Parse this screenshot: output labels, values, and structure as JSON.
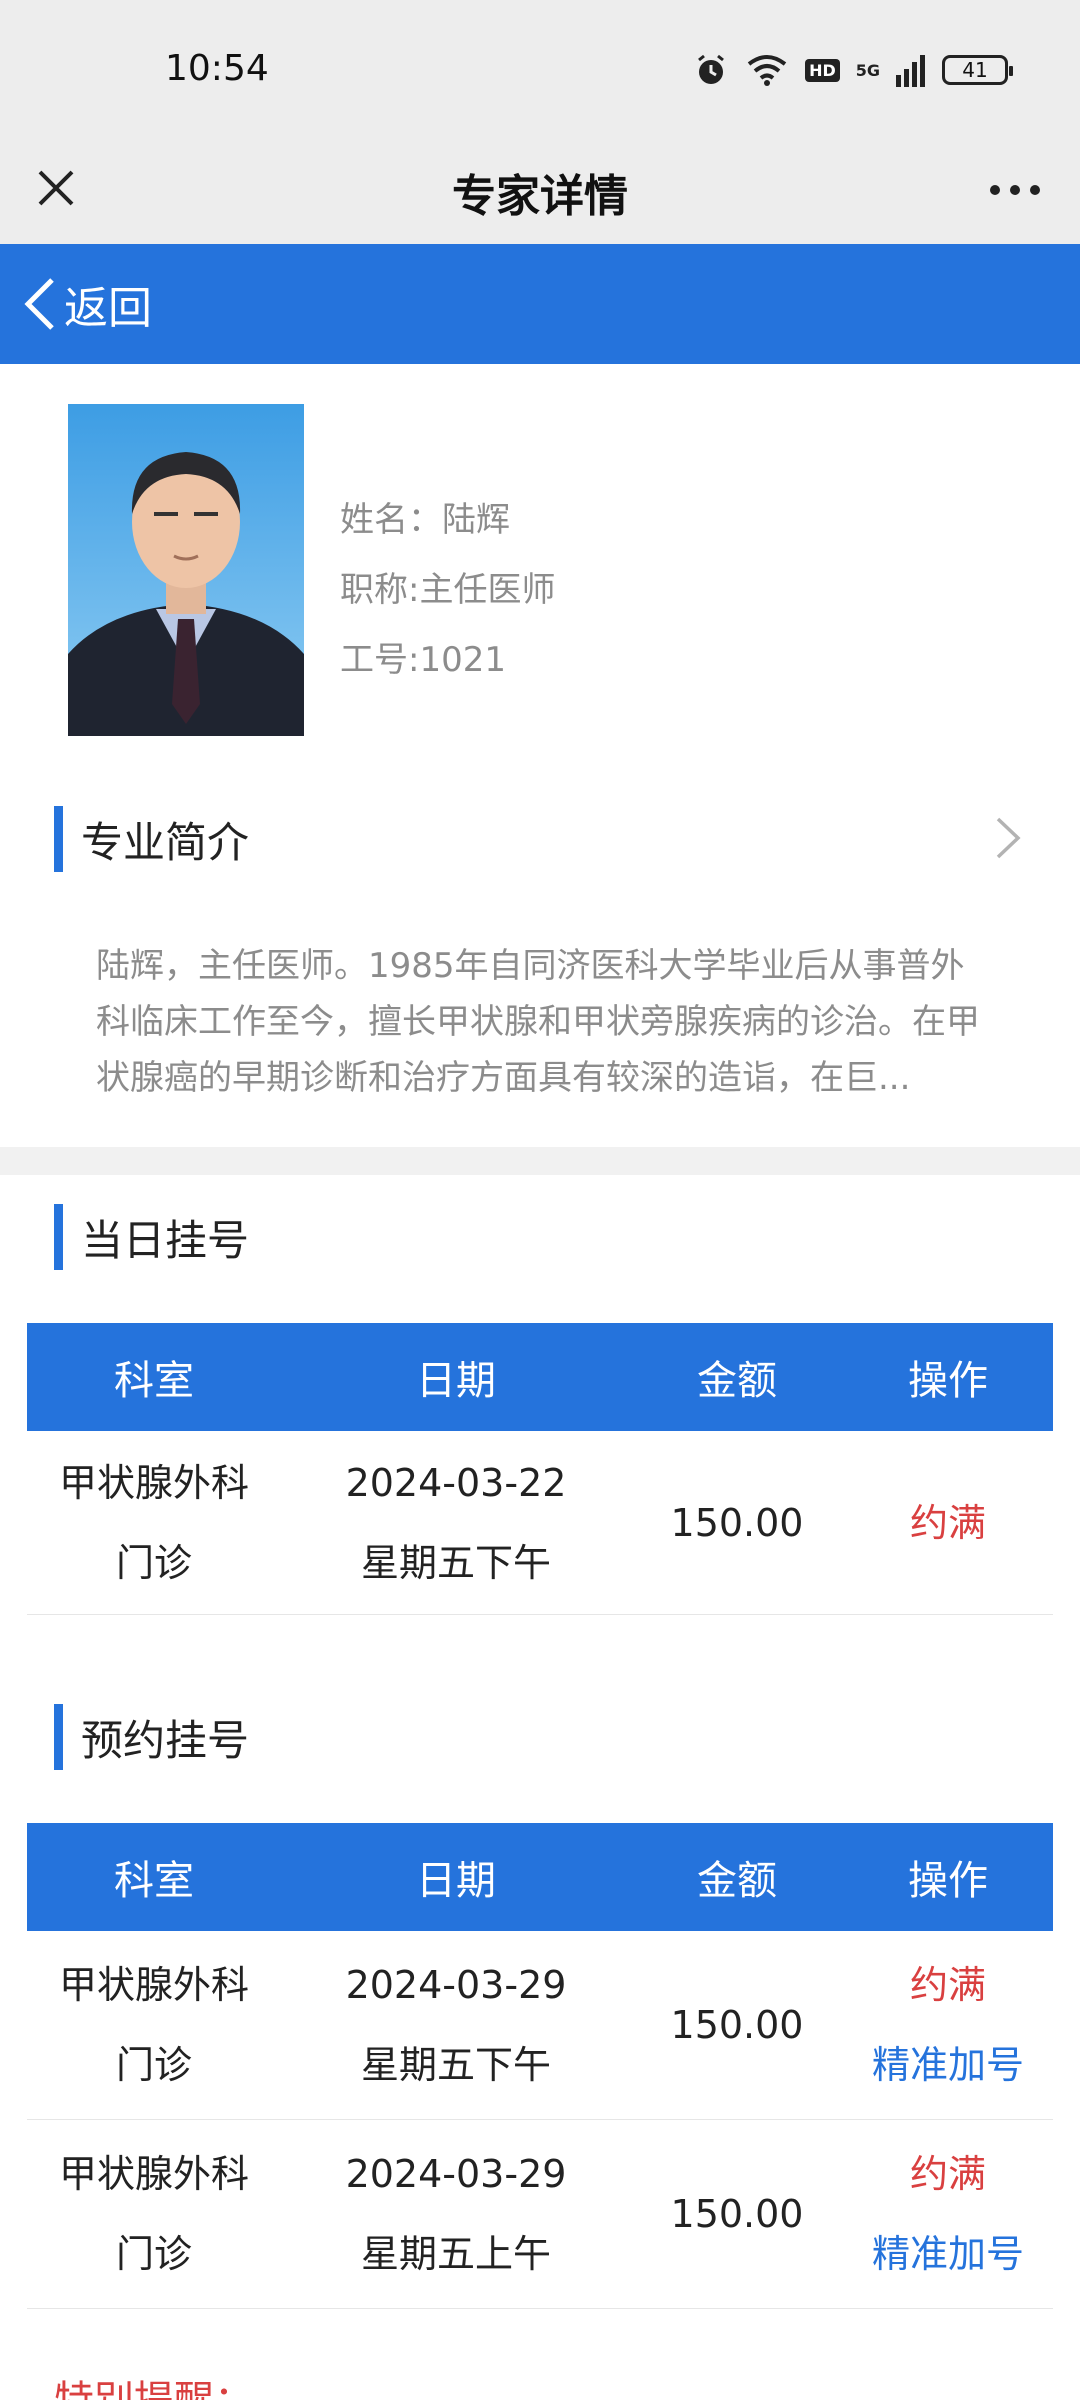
{
  "status_bar": {
    "time": "10:54",
    "battery": "41",
    "network": "5G",
    "hd": "HD"
  },
  "nav": {
    "title": "专家详情"
  },
  "back": {
    "label": "返回"
  },
  "doctor": {
    "name_label": "姓名：",
    "name": "陆辉",
    "title_label": "职称:",
    "title": "主任医师",
    "id_label": "工号:",
    "id": "1021"
  },
  "profile": {
    "heading": "专业简介",
    "text": "陆辉，主任医师。1985年自同济医科大学毕业后从事普外科临床工作至今，擅长甲状腺和甲状旁腺疾病的诊治。在甲状腺癌的早期诊断和治疗方面具有较深的造诣，在巨..."
  },
  "same_day": {
    "heading": "当日挂号",
    "columns": [
      "科室",
      "日期",
      "金额",
      "操作"
    ],
    "rows": [
      {
        "dept_line1": "甲状腺外科",
        "dept_line2": "门诊",
        "date": "2024-03-22",
        "session": "星期五下午",
        "amount": "150.00",
        "status": "约满"
      }
    ]
  },
  "appointment": {
    "heading": "预约挂号",
    "columns": [
      "科室",
      "日期",
      "金额",
      "操作"
    ],
    "rows": [
      {
        "dept_line1": "甲状腺外科",
        "dept_line2": "门诊",
        "date": "2024-03-29",
        "session": "星期五下午",
        "amount": "150.00",
        "status": "约满",
        "action": "精准加号"
      },
      {
        "dept_line1": "甲状腺外科",
        "dept_line2": "门诊",
        "date": "2024-03-29",
        "session": "星期五上午",
        "amount": "150.00",
        "status": "约满",
        "action": "精准加号"
      }
    ]
  },
  "notice": {
    "label": "特别提醒："
  },
  "colors": {
    "primary": "#2573dc",
    "full": "#d94040",
    "muted": "#8c8c8c"
  }
}
